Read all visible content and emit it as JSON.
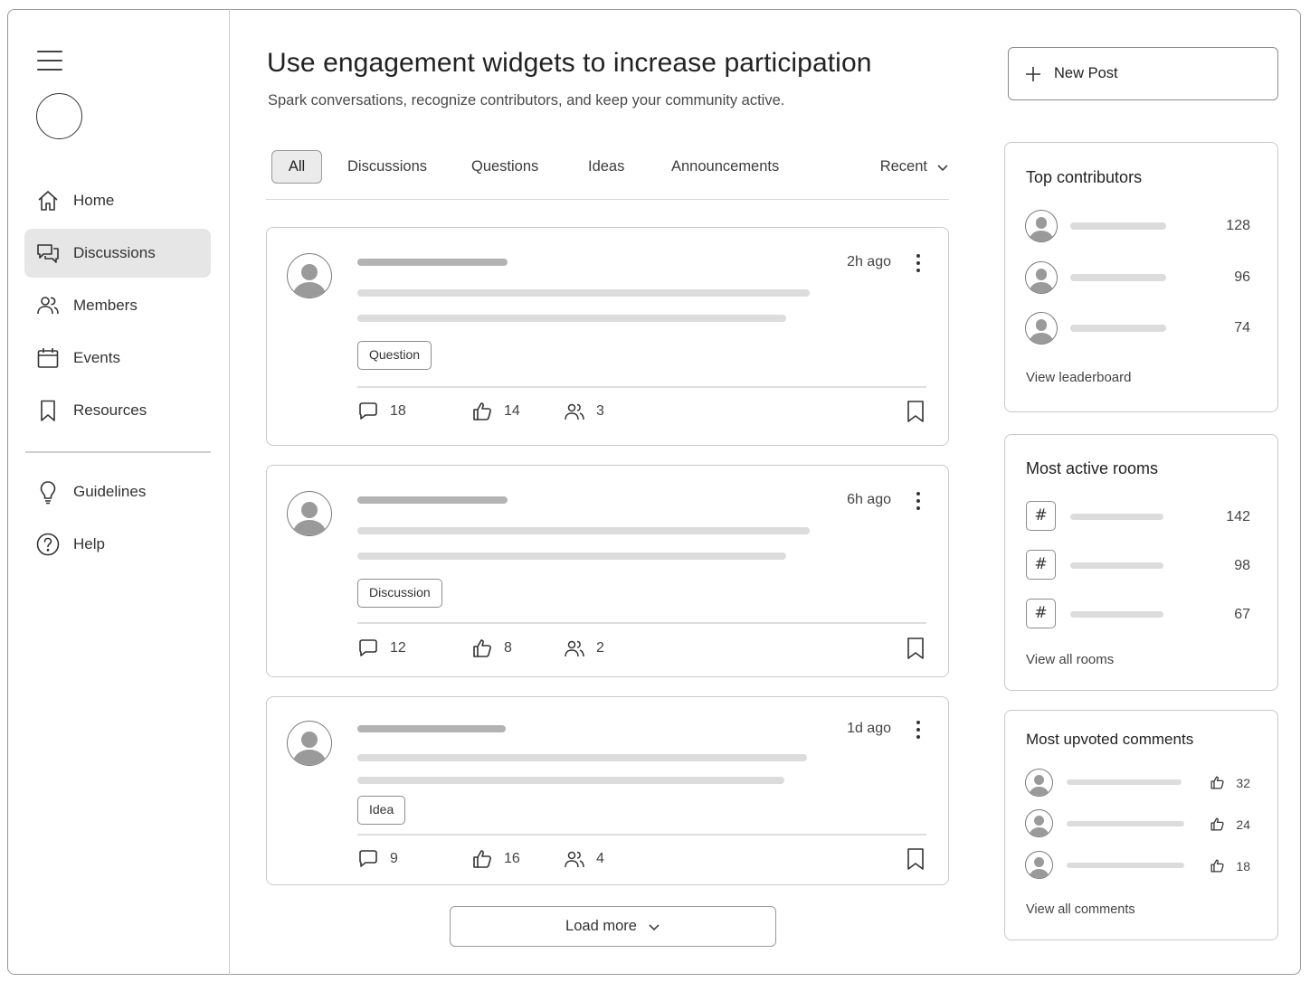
{
  "header": {
    "title": "Use engagement widgets to increase participation",
    "subtitle": "Spark conversations, recognize contributors, and keep your community active."
  },
  "sidebar": {
    "items": [
      {
        "label": "Home",
        "icon": "home-icon"
      },
      {
        "label": "Discussions",
        "icon": "chat-icon",
        "active": true
      },
      {
        "label": "Members",
        "icon": "members-icon"
      },
      {
        "label": "Events",
        "icon": "calendar-icon"
      },
      {
        "label": "Resources",
        "icon": "bookmark-icon"
      },
      {
        "label": "Guidelines",
        "icon": "lightbulb-icon"
      },
      {
        "label": "Help",
        "icon": "help-icon"
      }
    ]
  },
  "tabs": {
    "items": [
      "All",
      "Discussions",
      "Questions",
      "Ideas",
      "Announcements"
    ],
    "active": "All",
    "sort_label": "Recent"
  },
  "posts": [
    {
      "time": "2h ago",
      "tag": "Question",
      "comments": "18",
      "likes": "14",
      "participants": "3"
    },
    {
      "time": "6h ago",
      "tag": "Discussion",
      "comments": "12",
      "likes": "8",
      "participants": "2"
    },
    {
      "time": "1d ago",
      "tag": "Idea",
      "comments": "9",
      "likes": "16",
      "participants": "4"
    }
  ],
  "load_more_label": "Load more",
  "new_post_label": "New Post",
  "widgets": {
    "contributors": {
      "title": "Top contributors",
      "counts": [
        "128",
        "96",
        "74"
      ],
      "link": "View leaderboard"
    },
    "rooms": {
      "title": "Most active rooms",
      "icon_symbol": "#",
      "counts": [
        "142",
        "98",
        "67"
      ],
      "link": "View all rooms"
    },
    "comments": {
      "title": "Most upvoted comments",
      "counts": [
        "32",
        "24",
        "18"
      ],
      "link": "View all comments"
    }
  },
  "colors": {
    "border": "#c9c9c9",
    "active_bg": "#e6e6e6",
    "placeholder": "#dcdcdc",
    "placeholder_dark": "#b3b3b3"
  }
}
